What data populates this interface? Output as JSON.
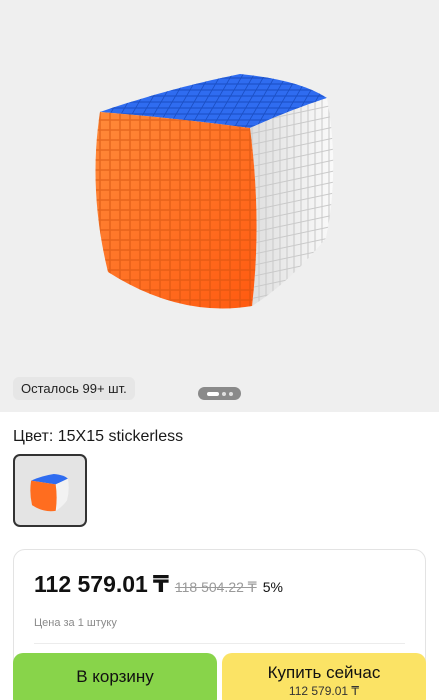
{
  "gallery": {
    "image_alt": "",
    "stock_badge": "Осталось 99+ шт.",
    "pager_icon": "carousel-dots-icon"
  },
  "variant": {
    "label": "Цвет: 15X15 stickerless",
    "selected_thumb_icon": "cube-thumbnail-icon"
  },
  "price": {
    "amount": "112 579.01",
    "currency": "₸",
    "old_amount": "118 504.22 ₸",
    "discount": "5%",
    "per_unit": "Цена за 1 штуку"
  },
  "actions": {
    "cart_label": "В корзину",
    "buy_label": "Купить сейчас",
    "buy_sub": "112 579.01 ₸"
  },
  "colors": {
    "gallery_bg": "#efefef",
    "cart_button": "#88d44a",
    "buy_button": "#fbe365",
    "cube_orange": "#ff6d1f",
    "cube_blue": "#2f6cf0",
    "cube_white": "#f4f4f4"
  }
}
